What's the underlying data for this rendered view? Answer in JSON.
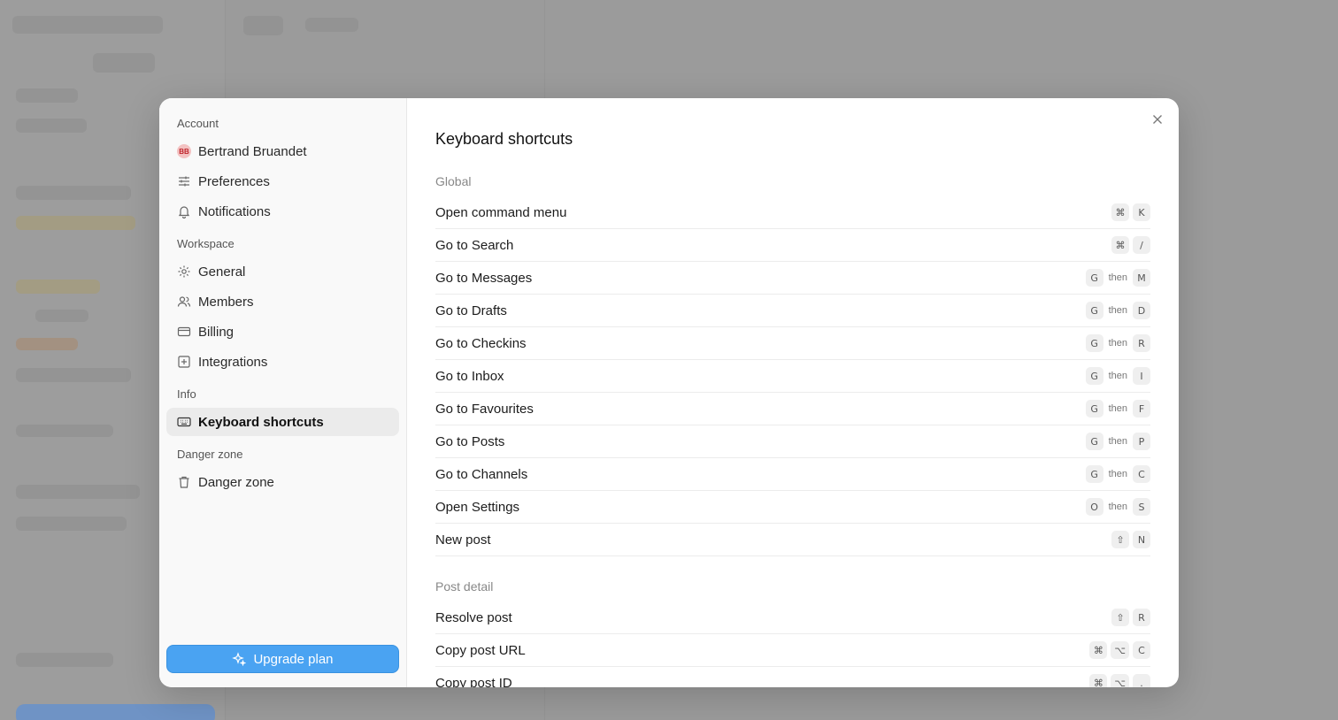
{
  "sidebar": {
    "sections": [
      {
        "label": "Account"
      },
      {
        "label": "Workspace"
      },
      {
        "label": "Info"
      },
      {
        "label": "Danger zone"
      }
    ],
    "items": [
      {
        "label": "Bertrand Bruandet",
        "avatar": "BB"
      },
      {
        "label": "Preferences"
      },
      {
        "label": "Notifications"
      },
      {
        "label": "General"
      },
      {
        "label": "Members"
      },
      {
        "label": "Billing"
      },
      {
        "label": "Integrations"
      },
      {
        "label": "Keyboard shortcuts",
        "active": true
      },
      {
        "label": "Danger zone"
      }
    ],
    "upgrade_label": "Upgrade plan"
  },
  "main": {
    "title": "Keyboard shortcuts",
    "groups": [
      {
        "label": "Global"
      },
      {
        "label": "Post detail"
      }
    ],
    "then": "then",
    "shortcuts": [
      {
        "label": "Open command menu",
        "keys": [
          "⌘",
          "K"
        ]
      },
      {
        "label": "Go to Search",
        "keys": [
          "⌘",
          "/"
        ]
      },
      {
        "label": "Go to Messages",
        "keys": [
          "G",
          "M"
        ]
      },
      {
        "label": "Go to Drafts",
        "keys": [
          "G",
          "D"
        ]
      },
      {
        "label": "Go to Checkins",
        "keys": [
          "G",
          "R"
        ]
      },
      {
        "label": "Go to Inbox",
        "keys": [
          "G",
          "I"
        ]
      },
      {
        "label": "Go to Favourites",
        "keys": [
          "G",
          "F"
        ]
      },
      {
        "label": "Go to Posts",
        "keys": [
          "G",
          "P"
        ]
      },
      {
        "label": "Go to Channels",
        "keys": [
          "G",
          "C"
        ]
      },
      {
        "label": "Open Settings",
        "keys": [
          "O",
          "S"
        ]
      },
      {
        "label": "New post",
        "keys": [
          "⇧",
          "N"
        ]
      },
      {
        "label": "Resolve post",
        "keys": [
          "⇧",
          "R"
        ]
      },
      {
        "label": "Copy post URL",
        "keys": [
          "⌘",
          "⌥",
          "C"
        ]
      },
      {
        "label": "Copy post ID",
        "keys": [
          "⌘",
          "⌥",
          "."
        ]
      }
    ]
  }
}
